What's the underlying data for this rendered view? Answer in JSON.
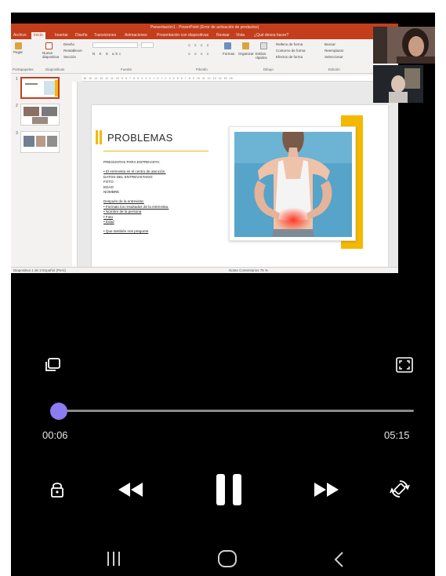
{
  "video": {
    "window_title": "Presentación1 - PowerPoint (Error de activación de productos)",
    "tabs": [
      "Archivo",
      "Inicio",
      "Insertar",
      "Diseño",
      "Transiciones",
      "Animaciones",
      "Presentación con diapositivas",
      "Revisar",
      "Vista"
    ],
    "active_tab_index": 1,
    "tell_me": "¿Qué desea hacer?",
    "ribbon": {
      "paste": "Pegar",
      "new_slide": "Nueva diapositiva",
      "layout": "Diseño",
      "reset": "Restablecer",
      "section": "Sección",
      "shapes": "Formas",
      "arrange": "Organizar",
      "quick_styles": "Estilos rápidos",
      "shape_fill": "Relleno de forma",
      "shape_outline": "Contorno de forma",
      "shape_effects": "Efectos de forma",
      "find": "Buscar",
      "replace": "Reemplazar",
      "select": "Seleccionar",
      "groups": [
        "Portapapeles",
        "Diapositivas",
        "Fuente",
        "Párrafo",
        "Dibujo",
        "Edición"
      ]
    },
    "ruler_text": "· 16 · 15 · 14 · 13 · 12 · 11 · 10 · 9 · 8 · 7 · 6 · 5 · 4 · 3 · 2 · 1 · 0 · 1 · 2 · 3 · 4 · 5 · 6 · 7 · 8 · 9 · 10 · 11 · 12 · 13 · 14 · 15 · 16",
    "thumbnail_numbers": [
      "1",
      "2",
      "3"
    ],
    "slide": {
      "title": "PROBLEMAS",
      "line1": "PREGUNTAS PARA ENTREVISTA:",
      "line2": "• El entrevista es el centro de atención.",
      "line3": "DATOS DEL ENTREVISTADO:",
      "line4": "FOTO",
      "line5": "EDAD",
      "line6": "NOMBRE",
      "line7": "Después de la entrevista:",
      "line8": "• Formato los resultados de la entrevista.",
      "line9": "• Nombre de la persona",
      "line10": "• Foto",
      "line11": "• Edad",
      "line12": "• Que también nos pregunte"
    },
    "status_left": "Diapositiva 1 de 3    Español (Perú)",
    "status_right": "Notas    Comentarios                                          75 %"
  },
  "player": {
    "time_current": "00:06",
    "time_total": "05:15",
    "progress_fraction": 0.019,
    "accent_color": "#8b7cf0"
  },
  "icons": {
    "popup": "popup-window-icon",
    "fullscreen": "fullscreen-icon",
    "lock": "lock-icon",
    "rewind": "rewind-icon",
    "pause": "pause-icon",
    "forward": "fast-forward-icon",
    "rotate": "screen-rotate-icon",
    "recents": "recents-icon",
    "home": "home-icon",
    "back": "back-icon"
  }
}
